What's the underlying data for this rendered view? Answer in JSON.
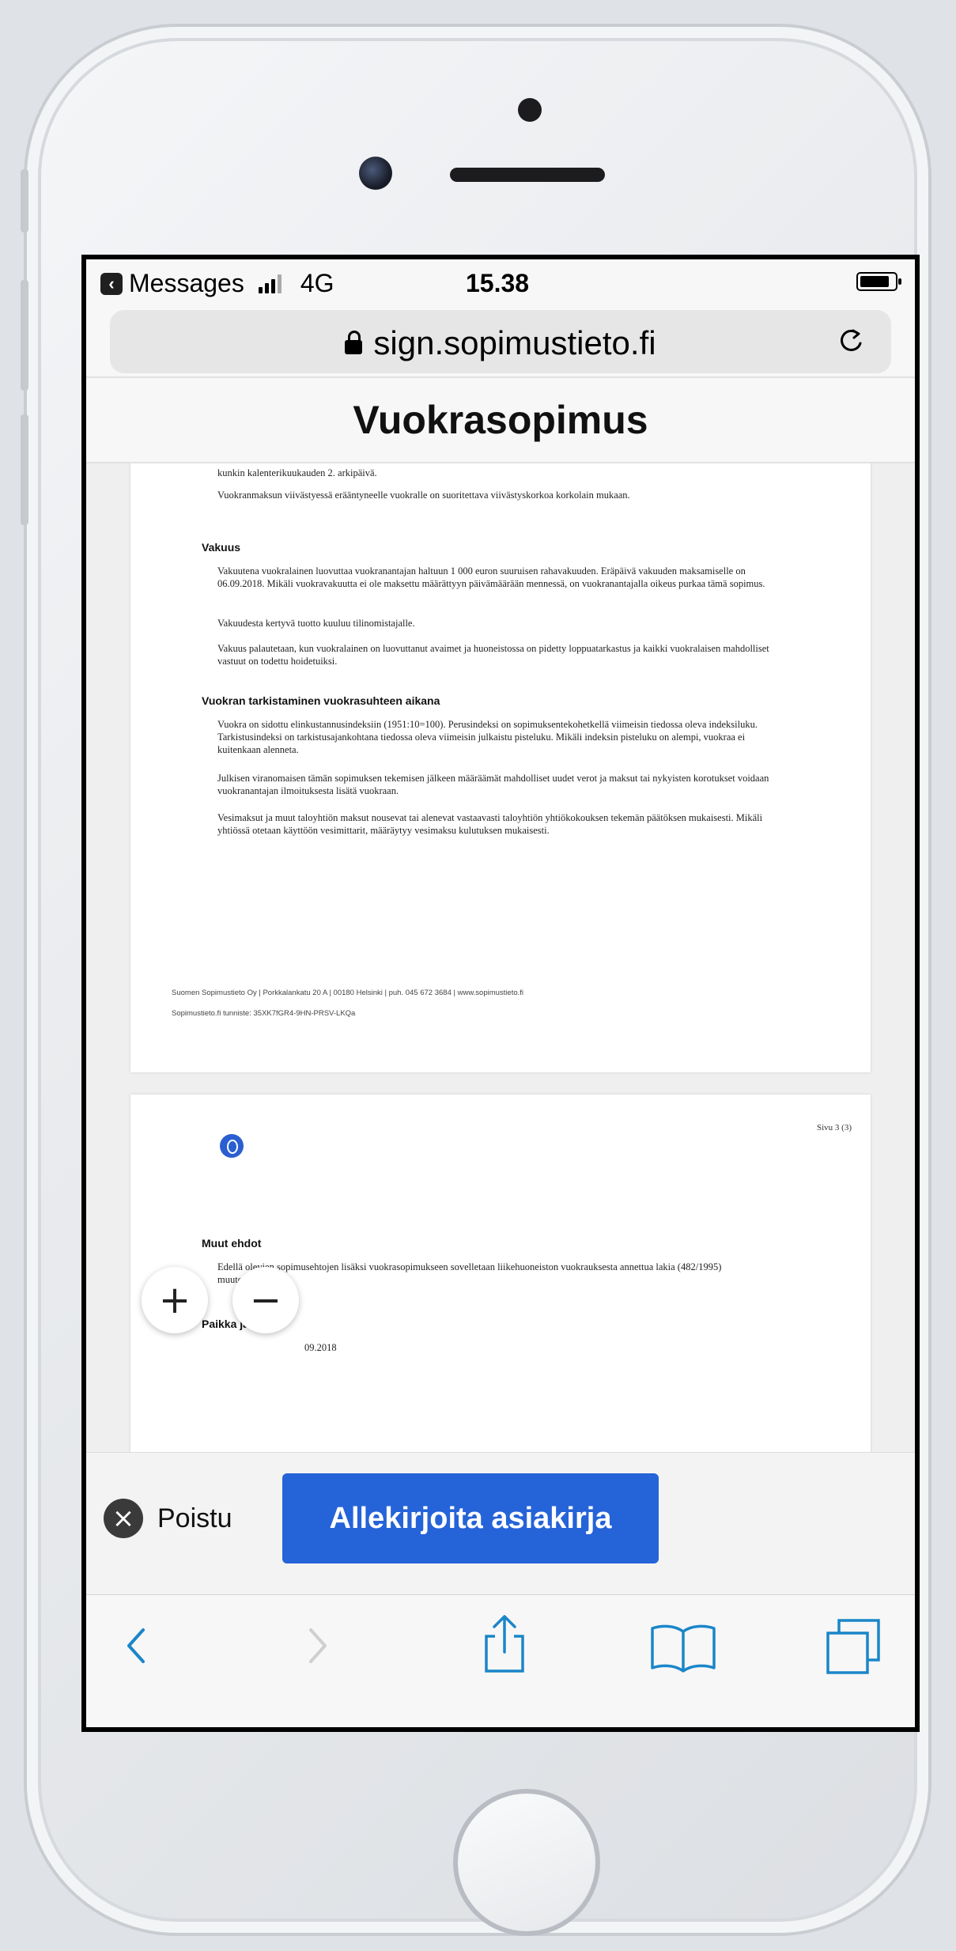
{
  "status_bar": {
    "back_app": "Messages",
    "network": "4G",
    "time": "15.38"
  },
  "address_bar": {
    "url": "sign.sopimustieto.fi"
  },
  "document": {
    "title": "Vuokrasopimus",
    "page1": {
      "lines_top": [
        "kunkin kalenterikuukauden 2. arkipäivä.",
        "Vuokranmaksun viivästyessä erääntyneelle vuokralle on suoritettava viivästyskorkoa korkolain mukaan."
      ],
      "section_deposit": {
        "heading": "Vakuus",
        "paragraphs": [
          "Vakuutena vuokralainen luovuttaa vuokranantajan haltuun 1 000 euron suuruisen rahavakuuden. Eräpäivä vakuuden maksamiselle on 06.09.2018. Mikäli vuokravakuutta ei ole maksettu määrättyyn päivämäärään mennessä, on vuokranantajalla oikeus purkaa tämä sopimus.",
          "Vakuudesta kertyvä tuotto kuuluu tilinomistajalle.",
          "Vakuus palautetaan, kun vuokralainen on luovuttanut avaimet ja huoneistossa on pidetty loppuatarkastus ja kaikki vuokralaisen mahdolliset vastuut on todettu hoidetuiksi."
        ]
      },
      "section_review": {
        "heading": "Vuokran tarkistaminen vuokrasuhteen aikana",
        "paragraphs": [
          "Vuokra on sidottu elinkustannusindeksiin (1951:10=100). Perusindeksi on sopimuksentekohetkellä viimeisin tiedossa oleva indeksiluku. Tarkistusindeksi on tarkistusajankohtana tiedossa oleva viimeisin julkaistu pisteluku. Mikäli indeksin pisteluku on alempi, vuokraa ei kuitenkaan alenneta.",
          "Julkisen viranomaisen tämän sopimuksen tekemisen jälkeen määräämät mahdolliset uudet verot ja maksut tai nykyisten korotukset voidaan vuokranantajan ilmoituksesta lisätä vuokraan.",
          "Vesimaksut ja muut taloyhtiön maksut nousevat tai alenevat vastaavasti taloyhtiön yhtiökokouksen tekemän päätöksen mukaisesti. Mikäli yhtiössä otetaan käyttöön vesimittarit, määräytyy vesimaksu kulutuksen mukaisesti."
        ]
      },
      "footer": [
        "Suomen Sopimustieto Oy | Porkkalankatu 20 A | 00180 Helsinki | puh. 045 672 3684 | www.sopimustieto.fi",
        "Sopimustieto.fi tunniste: 35XK7fGR4-9HN-PRSV-LKQa"
      ]
    },
    "page2": {
      "page_number": "Sivu 3 (3)",
      "section_other": {
        "heading": "Muut ehdot",
        "paragraphs": [
          "Edellä olevien sopimusehtojen lisäksi vuokrasopimukseen sovelletaan liikehuoneiston vuokrauksesta annettua lakia (482/1995) muutoksineen."
        ]
      },
      "section_place": {
        "heading": "Paikka ja aika",
        "value": "09.2018"
      }
    }
  },
  "zoom": {
    "in_label": "+",
    "out_label": "−"
  },
  "actions": {
    "exit_label": "Poistu",
    "sign_label": "Allekirjoita asiakirja"
  },
  "colors": {
    "accent": "#2563d8",
    "toolbar_icon": "#1a86c9"
  },
  "toolbar_icons": [
    "back-icon",
    "forward-icon",
    "share-icon",
    "bookmarks-icon",
    "tabs-icon"
  ]
}
